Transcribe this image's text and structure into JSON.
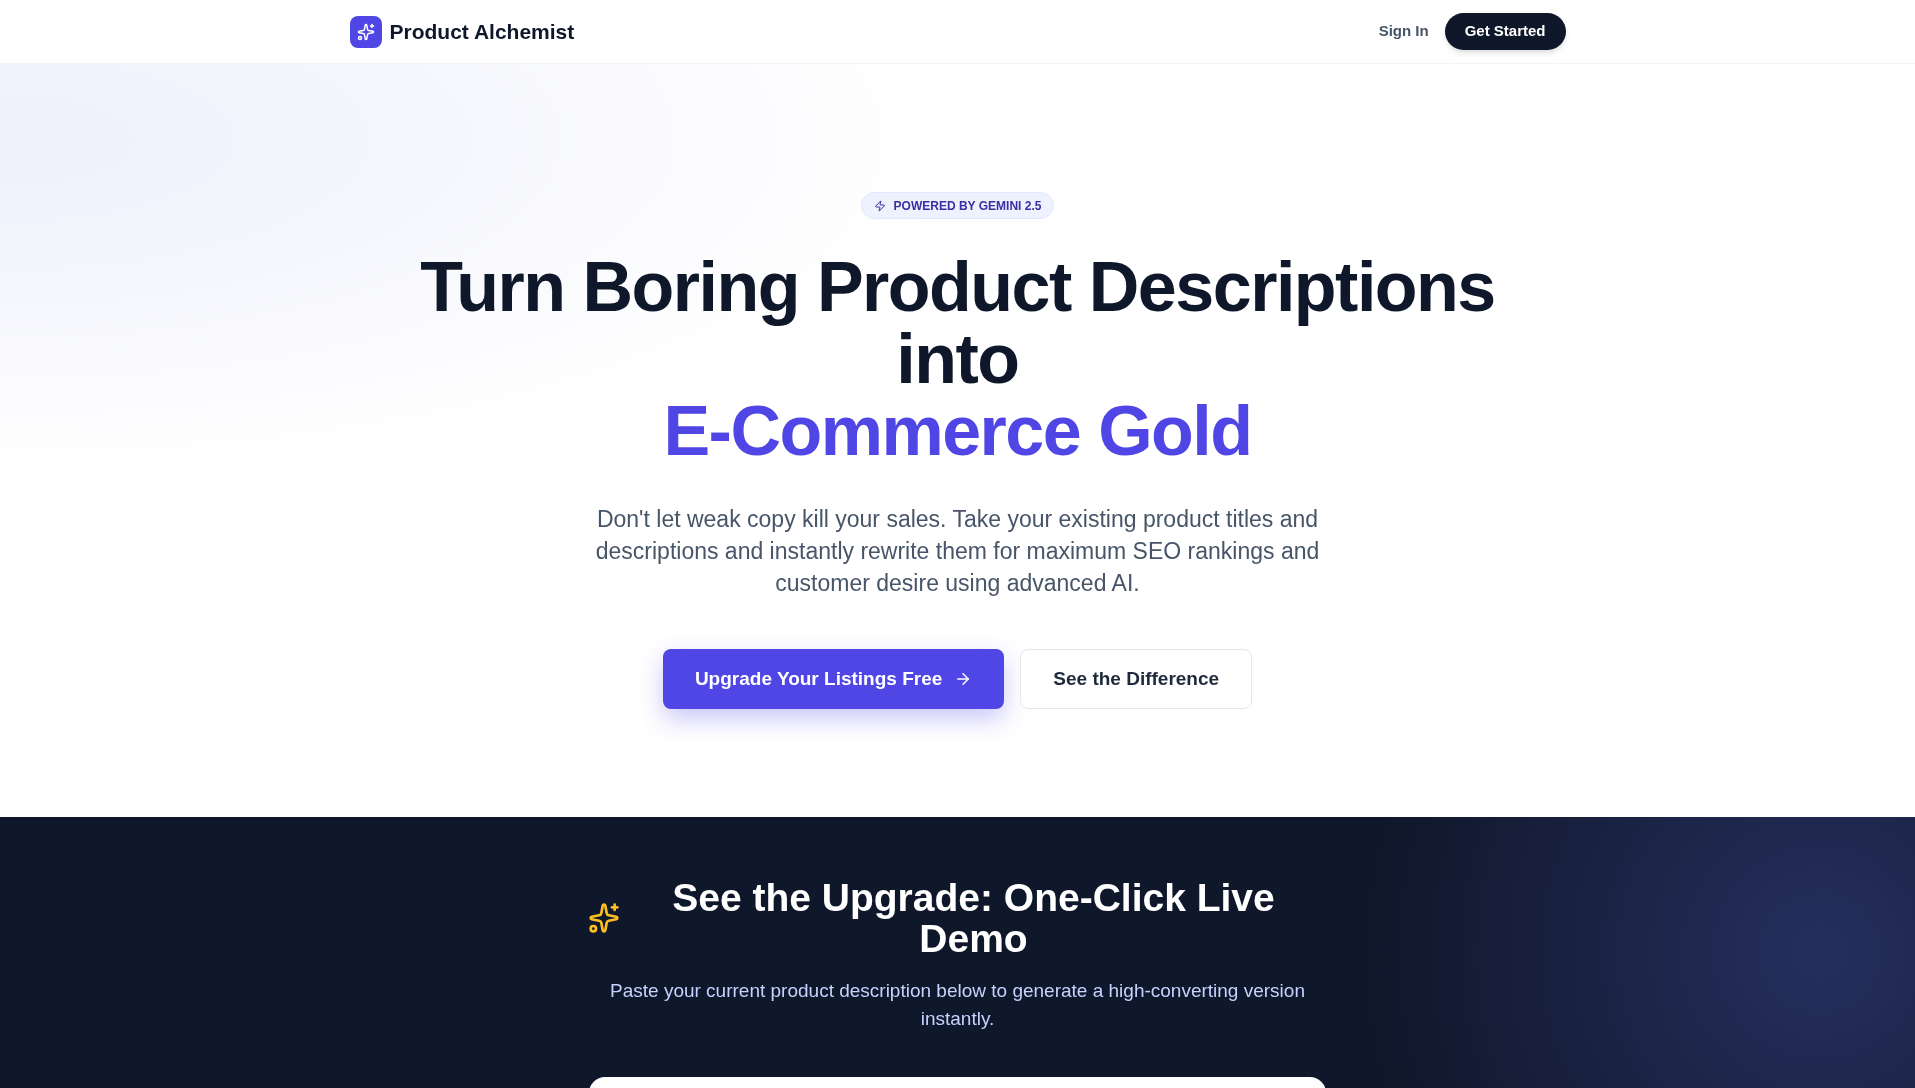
{
  "header": {
    "brand": "Product Alchemist",
    "sign_in": "Sign In",
    "cta": "Get Started"
  },
  "hero": {
    "badge": "POWERED BY GEMINI 2.5",
    "title_lines": [
      "Turn Boring Product Descriptions",
      "into"
    ],
    "title_highlight": "E-Commerce Gold",
    "subtitle": "Don't let weak copy kill your sales. Take your existing product titles and descriptions and instantly rewrite them for maximum SEO rankings and customer desire using advanced AI.",
    "primary_button": "Upgrade Your Listings Free",
    "secondary_button": "See the Difference"
  },
  "demo": {
    "title": "See the Upgrade: One-Click Live Demo",
    "subtitle": "Paste your current product description below to generate a high-converting version instantly."
  }
}
